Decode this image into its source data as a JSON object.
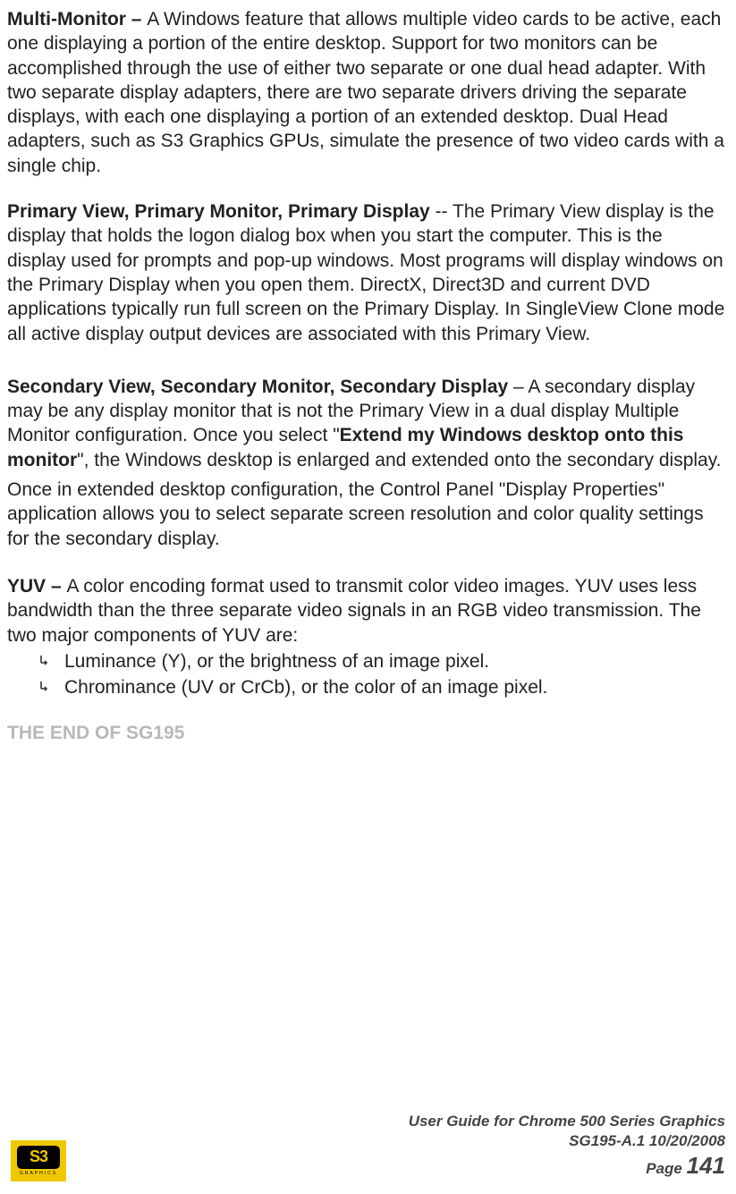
{
  "entries": {
    "multiMonitor": {
      "term": "Multi-Monitor – ",
      "body": "A Windows feature that allows multiple video cards to be active, each one displaying a portion of the entire desktop. Support for two monitors can be accomplished through the use of either two separate or one dual head adapter. With two separate display adapters, there are two separate drivers driving the separate displays, with each one displaying a portion of an extended desktop. Dual Head adapters, such as S3 Graphics GPUs, simulate the presence of two video cards with a single chip."
    },
    "primaryView": {
      "term": "Primary View, Primary Monitor, Primary Display",
      "sep": " -- ",
      "body": "The Primary View display is the display that holds the logon dialog box when you start the computer. This is the display used for prompts and pop-up windows. Most programs will display windows on the Primary Display when you open them. DirectX, Direct3D and current DVD applications typically run full screen on the Primary Display. In SingleView Clone mode all active display output devices are associated with this Primary View."
    },
    "secondaryView": {
      "term": "Secondary View, Secondary Monitor, Secondary Display",
      "sep": " – ",
      "body1a": "A secondary display may be any display monitor that is not the Primary View in a dual display Multiple Monitor configuration. Once you select \"",
      "boldPhrase": "Extend my Windows desktop onto this monitor",
      "body1b": "\", the Windows desktop is enlarged and extended onto the secondary display.",
      "body2": "Once in extended desktop configuration, the Control Panel \"Display Properties\" application allows you to select separate screen resolution and color quality settings for the secondary display."
    },
    "yuv": {
      "term": "YUV – ",
      "body": "A color encoding format used to transmit color video images. YUV uses less bandwidth than the three separate video signals in an RGB video transmission. The two major components of YUV are:",
      "bullets": [
        "Luminance (Y), or the brightness of an image pixel.",
        "Chrominance (UV or CrCb), or the color of an image pixel."
      ]
    }
  },
  "endMarker": "THE END OF SG195",
  "footer": {
    "title": "User Guide for Chrome 500 Series Graphics",
    "docRef": "SG195-A.1   10/20/2008",
    "pageWord": "Page ",
    "pageNum": "141",
    "logoText": "S3",
    "logoSub": "GRAPHICS"
  }
}
